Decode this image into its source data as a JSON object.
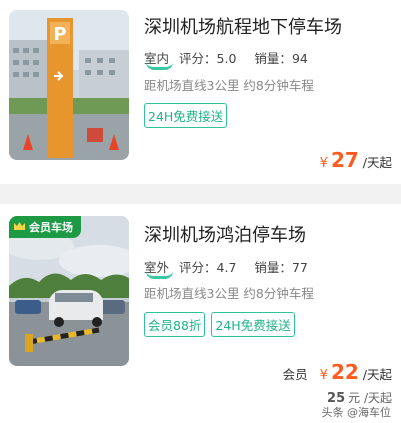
{
  "listings": [
    {
      "title": "深圳机场航程地下停车场",
      "type": "室内",
      "rating_label": "评分：",
      "rating": "5.0",
      "sales_label": "销量：",
      "sales": "94",
      "distance": "距机场直线3公里 约8分钟车程",
      "tags": [
        "24H免费接送"
      ],
      "price_symbol": "¥",
      "price": "27",
      "price_unit": "/天起"
    },
    {
      "badge": "会员车场",
      "title": "深圳机场鸿泊停车场",
      "type": "室外",
      "rating_label": "评分：",
      "rating": "4.7",
      "sales_label": "销量：",
      "sales": "77",
      "distance": "距机场直线3公里 约8分钟车程",
      "tags": [
        "会员88折",
        "24H免费接送"
      ],
      "member_label": "会员",
      "price_symbol": "¥",
      "price": "22",
      "price_unit": "/天起",
      "original_price": "25",
      "original_unit": "元 /天起"
    }
  ],
  "watermark": "头条 @海车位",
  "colors": {
    "accent_green": "#2ec39b",
    "price_orange": "#ff5a1f",
    "badge_green": "#1e9a45"
  }
}
